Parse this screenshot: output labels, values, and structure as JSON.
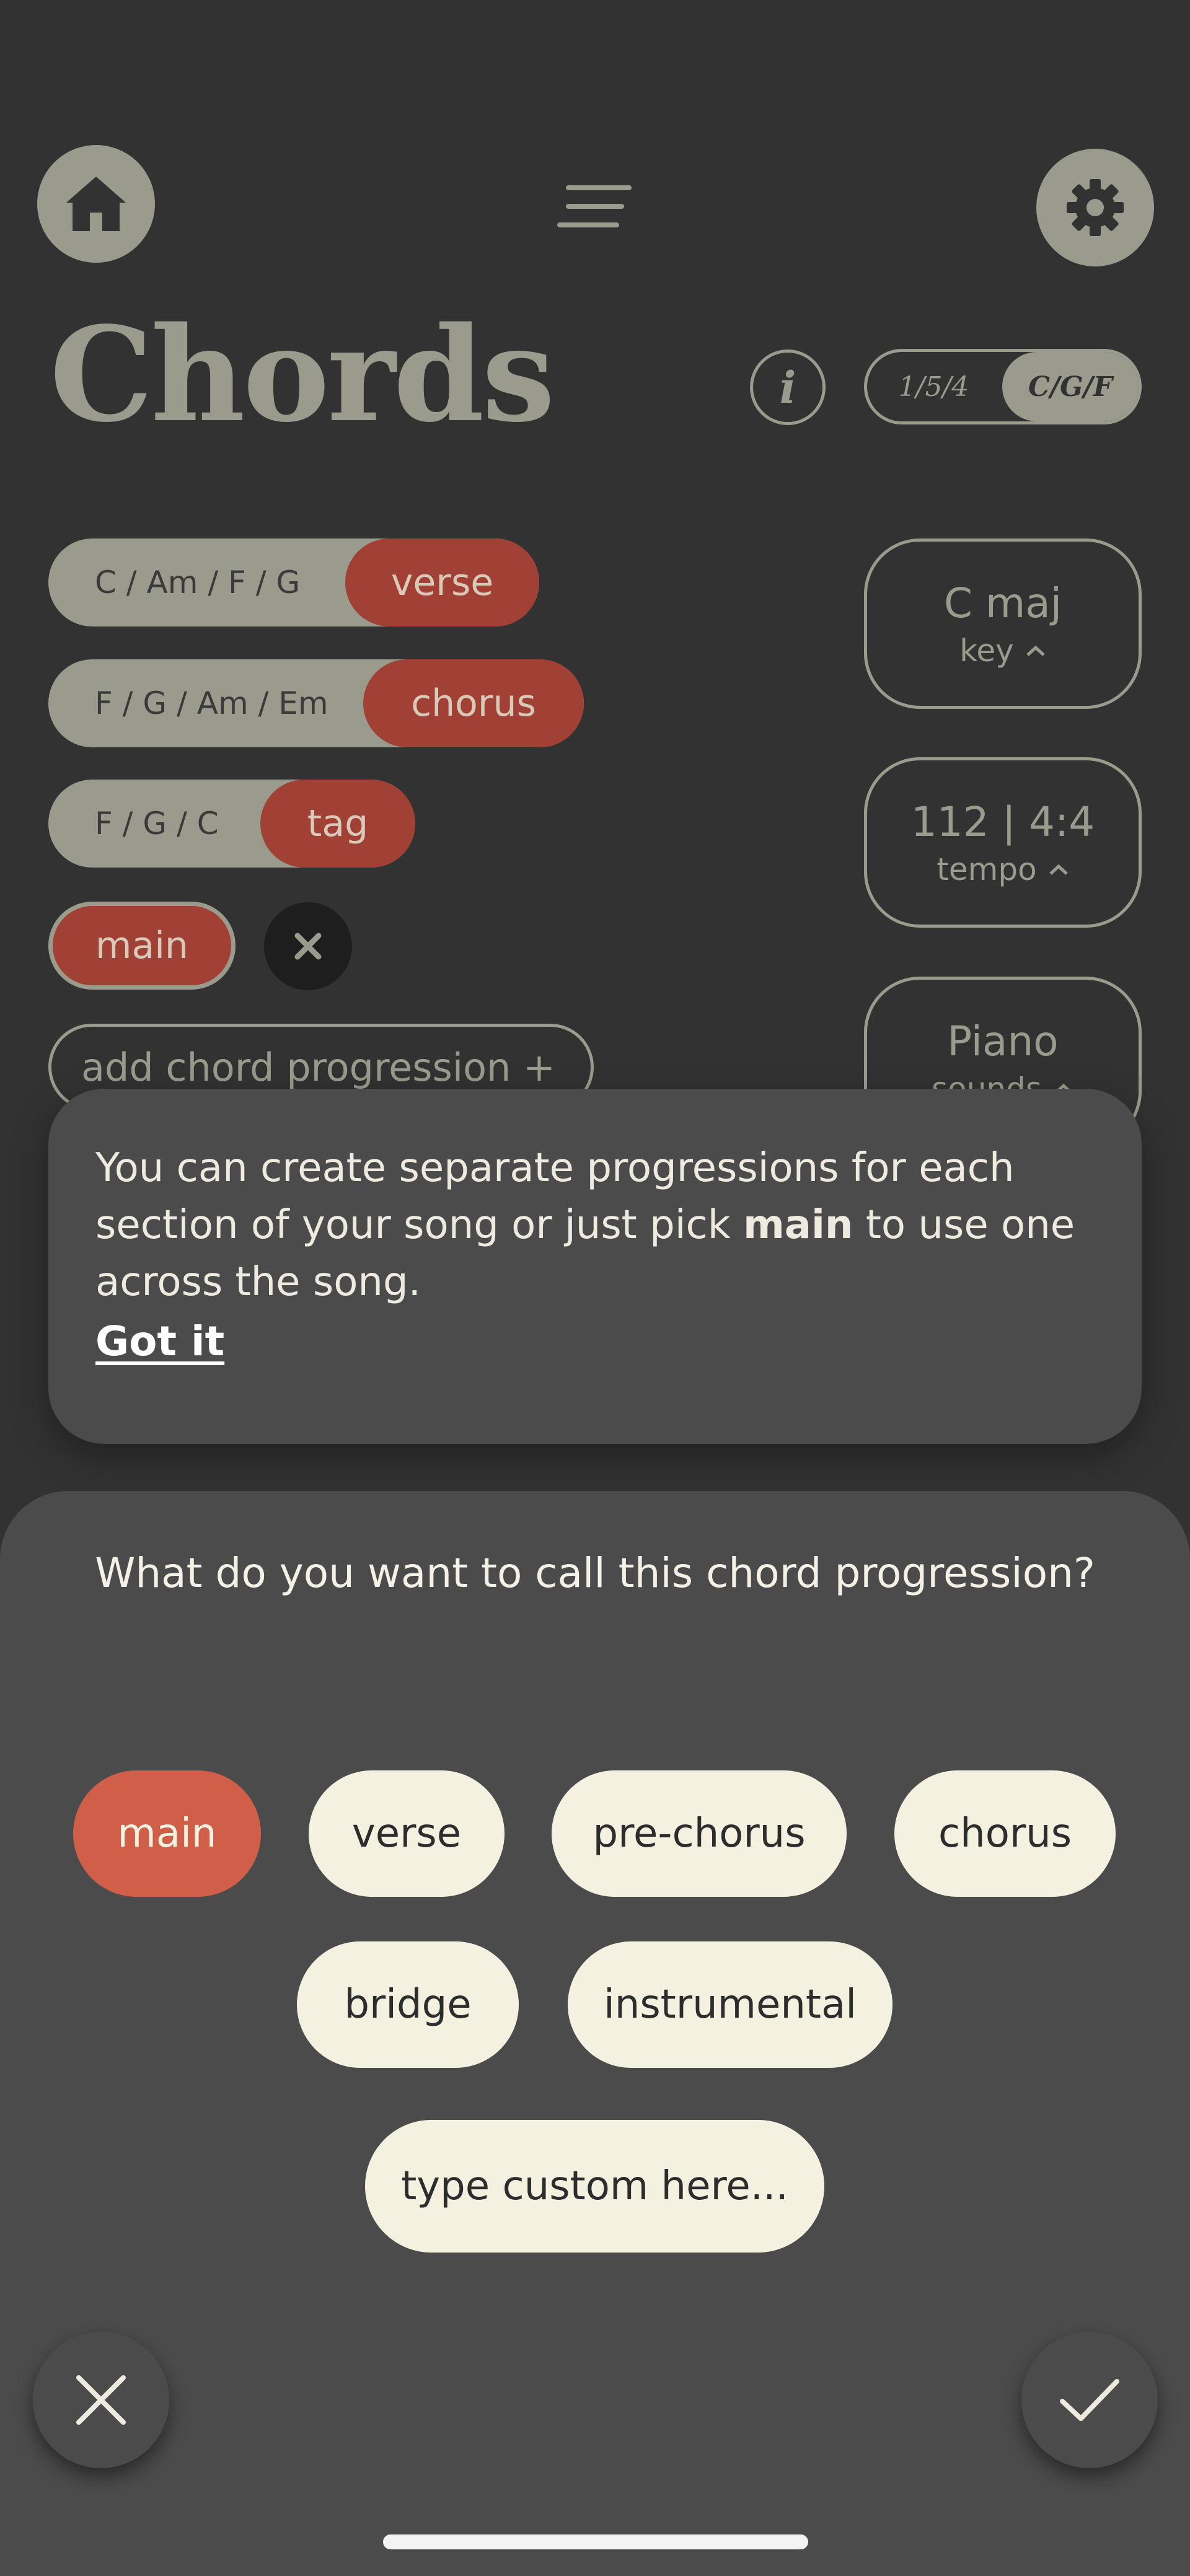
{
  "header": {
    "title": "Chords",
    "home_icon": "home-icon",
    "menu_icon": "menu-icon",
    "settings_icon": "gear-icon"
  },
  "mode_toggle": {
    "numbers_label": "1/5/4",
    "letters_label": "C/G/F",
    "selected": "C/G/F"
  },
  "progressions": [
    {
      "chords": "C / Am / F / G",
      "section": "verse"
    },
    {
      "chords": "F / G / Am / Em",
      "section": "chorus"
    },
    {
      "chords": "F / G / C",
      "section": "tag"
    }
  ],
  "new_progression": {
    "label": "main"
  },
  "add_progression_label": "add chord progression  +",
  "side_cards": {
    "key": {
      "value": "C maj",
      "label": "key"
    },
    "tempo": {
      "value": "112 | 4:4",
      "label": "tempo"
    },
    "sounds": {
      "value": "Piano",
      "label": "sounds"
    }
  },
  "tooltip": {
    "text_before": "You can create separate progressions for each section of your song or just pick ",
    "text_bold": "main",
    "text_after": " to use one across the song.",
    "dismiss_label": "Got it"
  },
  "sheet": {
    "question": "What do you want to call this chord progression?",
    "options": [
      "main",
      "verse",
      "pre-chorus",
      "chorus",
      "bridge",
      "instrumental"
    ],
    "selected": "main",
    "custom_placeholder": "type custom here..."
  },
  "colors": {
    "background": "#323232",
    "muted": "#9b9b8d",
    "accent": "#a14035",
    "selected_chip": "#cf5f49",
    "chip": "#f5f1e1"
  }
}
